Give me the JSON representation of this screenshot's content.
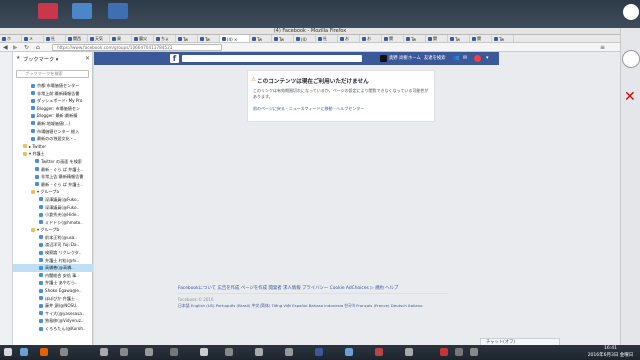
{
  "window": {
    "title": "(4) Facebook - Mozilla Firefox"
  },
  "tabs": [
    {
      "label": "ホ"
    },
    {
      "label": "メ"
    },
    {
      "label": "社"
    },
    {
      "label": "関西"
    },
    {
      "label": "天気"
    },
    {
      "label": "資"
    },
    {
      "label": "震災"
    },
    {
      "label": "ちょ"
    },
    {
      "label": "Tw"
    },
    {
      "label": "Tw"
    },
    {
      "label": "(4) ×",
      "active": true
    },
    {
      "label": "Tw"
    },
    {
      "label": "Tw"
    },
    {
      "label": "(4)"
    },
    {
      "label": "社"
    },
    {
      "label": "お"
    },
    {
      "label": "お"
    },
    {
      "label": "関"
    },
    {
      "label": "Tw"
    },
    {
      "label": "関"
    },
    {
      "label": "Tw"
    },
    {
      "label": "関"
    },
    {
      "label": "Tw"
    }
  ],
  "navbar": {
    "url": "https://www.facebook.com/groups/1066470411784521"
  },
  "sidebar": {
    "header": "ブックマーク ▾",
    "close": "✕",
    "search_placeholder": "ブックマークを検索",
    "items": [
      {
        "label": "京都:市場価値センター",
        "indent": 18
      },
      {
        "label": "非常上前:最新精報告書",
        "indent": 18
      },
      {
        "label": "ダッシュボード‹ My Pro",
        "indent": 18
      },
      {
        "label": "Blogger: 市場価値セン",
        "indent": 18
      },
      {
        "label": "Blogger: 最新:最新精",
        "indent": 18
      },
      {
        "label": "最新:地域価値(...)",
        "indent": 18
      },
      {
        "label": "市場価値センター 総入",
        "indent": 18
      },
      {
        "label": "最新のの独居文化・..",
        "indent": 18
      },
      {
        "label": "▸ Twitter",
        "indent": 10,
        "folder": true
      },
      {
        "label": "▾ 弁護士",
        "indent": 10,
        "folder": true
      },
      {
        "label": "Twitter の画面 を検索",
        "indent": 22
      },
      {
        "label": "最新 - ぐら ぱ 弁護士..",
        "indent": 22
      },
      {
        "label": "非常上告:最新精報告書",
        "indent": 22
      },
      {
        "label": "最新 - ぐら ぱ 弁護士..",
        "indent": 22
      },
      {
        "label": "▾ グループa",
        "indent": 18,
        "folder": true
      },
      {
        "label": "深澤議員(@Fuko..",
        "indent": 26
      },
      {
        "label": "深澤議員(@Fuko..",
        "indent": 26
      },
      {
        "label": "小倉秀夫(@Hide..",
        "indent": 26
      },
      {
        "label": "ミドトシ(@hmoto..",
        "indent": 26
      },
      {
        "label": "▾ グループb",
        "indent": 18,
        "folder": true
      },
      {
        "label": "前本正利(@usa..",
        "indent": 26
      },
      {
        "label": "渡辺洋司 Yuji Da..",
        "indent": 26
      },
      {
        "label": "検察論 リクレクタ..",
        "indent": 26
      },
      {
        "label": "弁護士 村松(@hi..",
        "indent": 26
      },
      {
        "label": "高橋善(@高橋..",
        "indent": 26,
        "selected": true
      },
      {
        "label": "内閣総合 安倍 事..",
        "indent": 26
      },
      {
        "label": "弁護士 あやむら..",
        "indent": 26
      },
      {
        "label": "Shoko Egawa@e..",
        "indent": 26
      },
      {
        "label": "ほぼびか 弁護士 ..",
        "indent": 26
      },
      {
        "label": "藤井 頭(@NOSU..",
        "indent": 26
      },
      {
        "label": "サイ大(@yasesasa..",
        "indent": 26
      },
      {
        "label": "独島帥(@Vidyeruz..",
        "indent": 26
      },
      {
        "label": "くろろたん(@Kuroh..",
        "indent": 26
      }
    ]
  },
  "facebook": {
    "logo": "f",
    "nav": {
      "user": "奥野 尚樹",
      "home": "ホーム",
      "find_friends": "友達を検索"
    },
    "card": {
      "icon": "⚠",
      "title": "このコンテンツは現在ご利用いただけません",
      "body": "このリンクは有効期限切れになっているか、ページの設定により閲覧できなくなっている可能性があります。",
      "links": "前のページに戻る · ニュースフィードに移動 · ヘルプセンター"
    },
    "footer": {
      "links": "Facebookについて  広告を作成  ページを作成  開発者  求人情報  プライバシー  Cookie  AdChoices ▷  規約  ヘルプ",
      "copyright": "Facebook © 2016",
      "languages": "日本語  English (US)  Português (Brasil)  中文(简体)  Tiếng Việt  Español  Bahasa Indonesia  한국어  Français (France)  Deutsch  Italiano"
    },
    "chat": {
      "label": "チャット(オフ)"
    }
  },
  "clock": {
    "time": "16:41",
    "date": "2016年6月3日 金曜日"
  }
}
